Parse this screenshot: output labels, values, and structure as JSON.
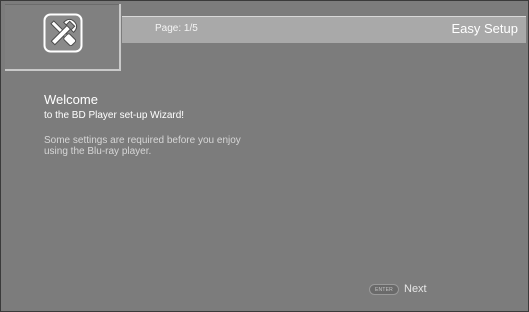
{
  "header": {
    "page_indicator": "Page: 1/5",
    "title": "Easy Setup"
  },
  "icon": {
    "name": "wrench-screwdriver-icon"
  },
  "main": {
    "welcome_title": "Welcome",
    "welcome_subtitle": "to the BD Player set-up Wizard!",
    "description_line1": "Some settings are required before you enjoy",
    "description_line2": "using the Blu-ray player."
  },
  "footer": {
    "enter_key_label": "ENTER",
    "next_label": "Next"
  },
  "colors": {
    "background": "#7c7c7c",
    "header_bar": "#a9a9a9",
    "text": "#ffffff",
    "description_text": "#d6d6d6"
  }
}
